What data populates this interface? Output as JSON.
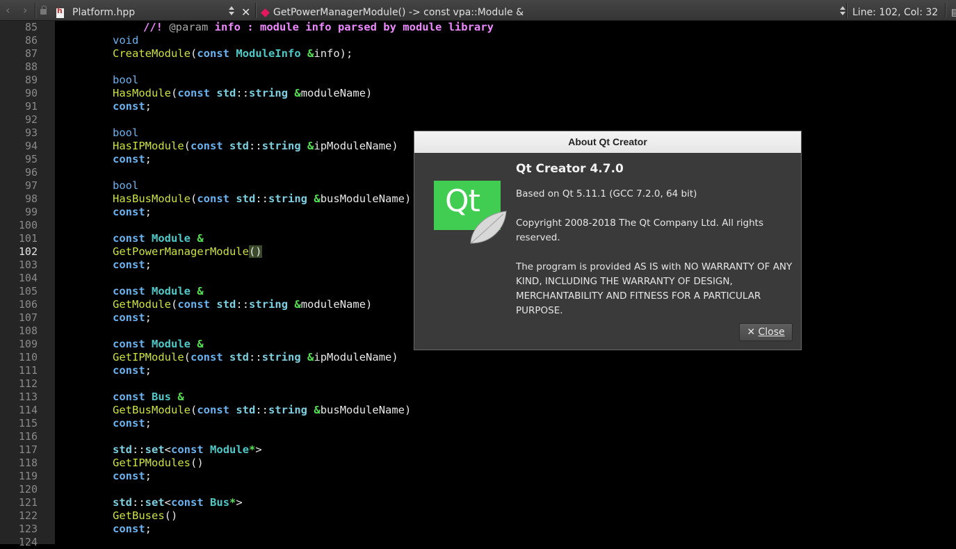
{
  "toolbar": {
    "back_icon": "chevron-left-icon",
    "forward_icon": "chevron-right-icon",
    "file_name": "Platform.hpp",
    "close_glyph": "✕",
    "symbol": "GetPowerManagerModule() -> const vpa::Module &",
    "position": "Line: 102, Col: 32"
  },
  "editor": {
    "current_line": 102,
    "line_numbers": [
      "85",
      "86",
      "87",
      "88",
      "89",
      "90",
      "91",
      "92",
      "93",
      "94",
      "95",
      "96",
      "97",
      "98",
      "99",
      "100",
      "101",
      "102",
      "103",
      "104",
      "105",
      "106",
      "107",
      "108",
      "109",
      "110",
      "111",
      "112",
      "113",
      "114",
      "115",
      "116",
      "117",
      "118",
      "119",
      "120",
      "121",
      "122",
      "123",
      "124"
    ]
  },
  "dialog": {
    "title": "About Qt Creator",
    "logo_text": "Qt",
    "heading": "Qt Creator 4.7.0",
    "based_on": "Based on Qt 5.11.1 (GCC 7.2.0, 64 bit)",
    "copyright": "Copyright 2008-2018 The Qt Company Ltd. All rights reserved.",
    "warranty": "The program is provided AS IS with NO WARRANTY OF ANY KIND, INCLUDING THE WARRANTY OF DESIGN, MERCHANTABILITY AND FITNESS FOR A PARTICULAR PURPOSE.",
    "close_label": "Close",
    "close_icon": "close-x-icon"
  },
  "colors": {
    "keyword": "#6bb3f0",
    "type": "#4fc8c8",
    "function": "#cde23e",
    "comment": "#ee88ff",
    "qt_green": "#41cd52"
  }
}
